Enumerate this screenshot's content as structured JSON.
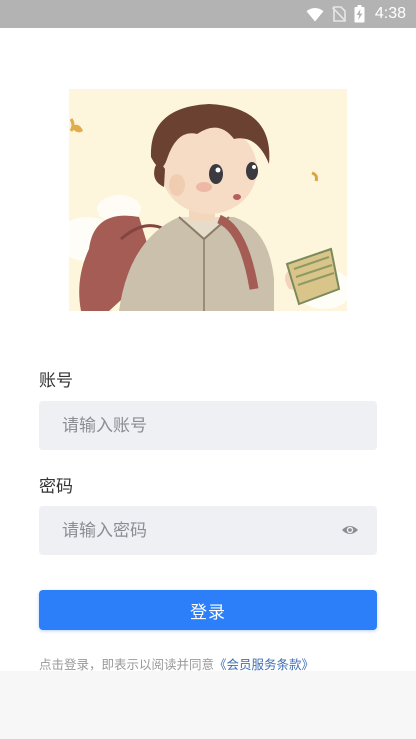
{
  "status_bar": {
    "time": "4:38",
    "icons": [
      "wifi-icon",
      "no-sim-icon",
      "battery-charging-icon"
    ],
    "background": "#b3b3b3"
  },
  "hero": {
    "icon": "boy-with-backpack-illustration"
  },
  "form": {
    "account_label": "账号",
    "account_placeholder": "请输入账号",
    "password_label": "密码",
    "password_placeholder": "请输入密码",
    "toggle_visibility_icon": "eye-icon",
    "login_label": "登录",
    "login_color": "#2d7ff9",
    "input_background": "#eef0f4"
  },
  "agreement": {
    "prefix": "点击登录，即表示以阅读并同意",
    "link": "《会员服务条款》",
    "link_color": "#3d6fb6"
  }
}
